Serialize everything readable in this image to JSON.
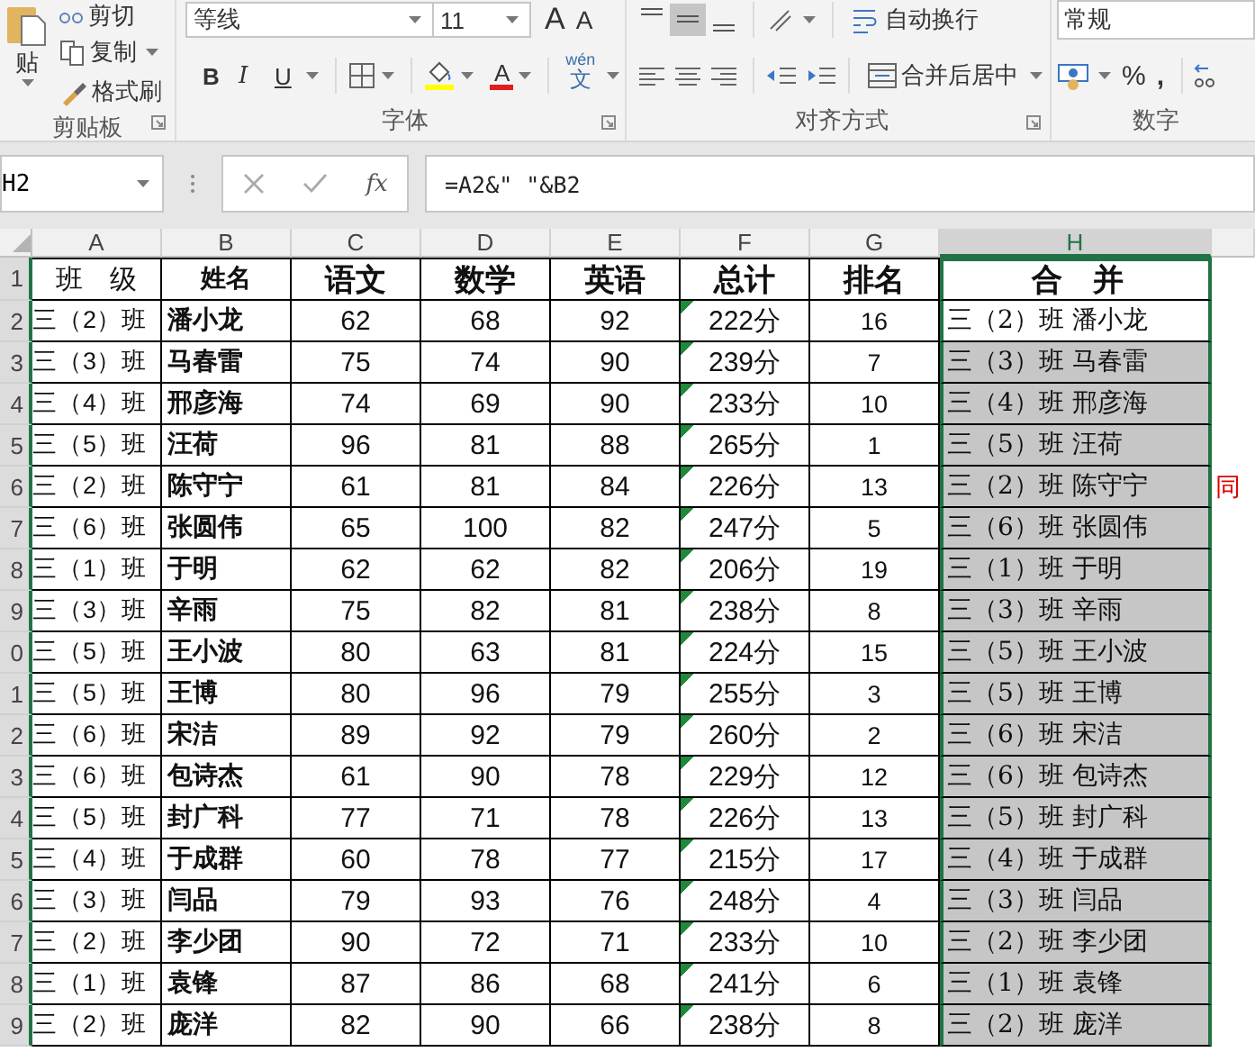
{
  "ribbon": {
    "clipboard": {
      "paste": "贴",
      "cut": "剪切",
      "copy": "复制",
      "format_painter": "格式刷",
      "label": "剪贴板"
    },
    "font": {
      "name": "等线",
      "size": "11",
      "grow": "A",
      "shrink": "A",
      "bold": "B",
      "italic": "I",
      "underline": "U",
      "font_color": "A",
      "phonetic_top": "wén",
      "phonetic_bottom": "文",
      "label": "字体"
    },
    "alignment": {
      "vertical_align": [
        {
          "selected": false
        },
        {
          "selected": true
        },
        {
          "selected": false
        }
      ],
      "wrap": "自动换行",
      "merge": "合并后居中",
      "label": "对齐方式"
    },
    "number": {
      "format": "常规",
      "percent": "%",
      "comma": ",",
      "label": "数字"
    }
  },
  "formula_bar": {
    "name_box": "H2",
    "function_button": "fx",
    "formula": "=A2&\" \"&B2"
  },
  "sheet": {
    "columns": [
      {
        "label": "A",
        "selected": false
      },
      {
        "label": "B",
        "selected": false
      },
      {
        "label": "C",
        "selected": false
      },
      {
        "label": "D",
        "selected": false
      },
      {
        "label": "E",
        "selected": false
      },
      {
        "label": "F",
        "selected": false
      },
      {
        "label": "G",
        "selected": false
      },
      {
        "label": "H",
        "selected": true
      }
    ],
    "header_row": {
      "row": "1",
      "selected": true,
      "cells": [
        "班　级",
        "姓名",
        "语文",
        "数学",
        "英语",
        "总计",
        "排名",
        "合　并"
      ]
    },
    "rows": [
      {
        "row": "2",
        "selected": true,
        "cells": [
          "三（2）班",
          "潘小龙",
          "62",
          "68",
          "92",
          "222分",
          "16"
        ],
        "warning": true,
        "merged": "三（2）班 潘小龙",
        "highlighted": false
      },
      {
        "row": "3",
        "selected": true,
        "cells": [
          "三（3）班",
          "马春雷",
          "75",
          "74",
          "90",
          "239分",
          "7"
        ],
        "warning": true,
        "merged": "三（3）班 马春雷",
        "highlighted": true
      },
      {
        "row": "4",
        "selected": true,
        "cells": [
          "三（4）班",
          "邢彦海",
          "74",
          "69",
          "90",
          "233分",
          "10"
        ],
        "warning": true,
        "merged": "三（4）班 邢彦海",
        "highlighted": true
      },
      {
        "row": "5",
        "selected": true,
        "cells": [
          "三（5）班",
          "汪荷",
          "96",
          "81",
          "88",
          "265分",
          "1"
        ],
        "warning": true,
        "merged": "三（5）班 汪荷",
        "highlighted": true
      },
      {
        "row": "6",
        "selected": true,
        "cells": [
          "三（2）班",
          "陈守宁",
          "61",
          "81",
          "84",
          "226分",
          "13"
        ],
        "warning": true,
        "merged": "三（2）班 陈守宁",
        "highlighted": true,
        "note": "同"
      },
      {
        "row": "7",
        "selected": true,
        "cells": [
          "三（6）班",
          "张圆伟",
          "65",
          "100",
          "82",
          "247分",
          "5"
        ],
        "warning": true,
        "merged": "三（6）班 张圆伟",
        "highlighted": true
      },
      {
        "row": "8",
        "selected": true,
        "cells": [
          "三（1）班",
          "于明",
          "62",
          "62",
          "82",
          "206分",
          "19"
        ],
        "warning": true,
        "merged": "三（1）班 于明",
        "highlighted": true
      },
      {
        "row": "9",
        "selected": true,
        "cells": [
          "三（3）班",
          "辛雨",
          "75",
          "82",
          "81",
          "238分",
          "8"
        ],
        "warning": true,
        "merged": "三（3）班 辛雨",
        "highlighted": true
      },
      {
        "row": "0",
        "selected": true,
        "cells": [
          "三（5）班",
          "王小波",
          "80",
          "63",
          "81",
          "224分",
          "15"
        ],
        "warning": true,
        "merged": "三（5）班 王小波",
        "highlighted": true
      },
      {
        "row": "1",
        "selected": true,
        "cells": [
          "三（5）班",
          "王博",
          "80",
          "96",
          "79",
          "255分",
          "3"
        ],
        "warning": true,
        "merged": "三（5）班 王博",
        "highlighted": true
      },
      {
        "row": "2",
        "selected": true,
        "cells": [
          "三（6）班",
          "宋洁",
          "89",
          "92",
          "79",
          "260分",
          "2"
        ],
        "warning": true,
        "merged": "三（6）班 宋洁",
        "highlighted": true
      },
      {
        "row": "3",
        "selected": true,
        "cells": [
          "三（6）班",
          "包诗杰",
          "61",
          "90",
          "78",
          "229分",
          "12"
        ],
        "warning": true,
        "merged": "三（6）班 包诗杰",
        "highlighted": true
      },
      {
        "row": "4",
        "selected": true,
        "cells": [
          "三（5）班",
          "封广科",
          "77",
          "71",
          "78",
          "226分",
          "13"
        ],
        "warning": true,
        "merged": "三（5）班 封广科",
        "highlighted": true
      },
      {
        "row": "5",
        "selected": true,
        "cells": [
          "三（4）班",
          "于成群",
          "60",
          "78",
          "77",
          "215分",
          "17"
        ],
        "warning": true,
        "merged": "三（4）班 于成群",
        "highlighted": true
      },
      {
        "row": "6",
        "selected": true,
        "cells": [
          "三（3）班",
          "闫品",
          "79",
          "93",
          "76",
          "248分",
          "4"
        ],
        "warning": true,
        "merged": "三（3）班 闫品",
        "highlighted": true
      },
      {
        "row": "7",
        "selected": true,
        "cells": [
          "三（2）班",
          "李少团",
          "90",
          "72",
          "71",
          "233分",
          "10"
        ],
        "warning": true,
        "merged": "三（2）班 李少团",
        "highlighted": true
      },
      {
        "row": "8",
        "selected": true,
        "cells": [
          "三（1）班",
          "袁锋",
          "87",
          "86",
          "68",
          "241分",
          "6"
        ],
        "warning": true,
        "merged": "三（1）班 袁锋",
        "highlighted": true
      },
      {
        "row": "9",
        "selected": true,
        "cells": [
          "三（2）班",
          "庞洋",
          "82",
          "90",
          "66",
          "238分",
          "8"
        ],
        "warning": true,
        "merged": "三（2）班 庞洋",
        "highlighted": true
      }
    ]
  }
}
